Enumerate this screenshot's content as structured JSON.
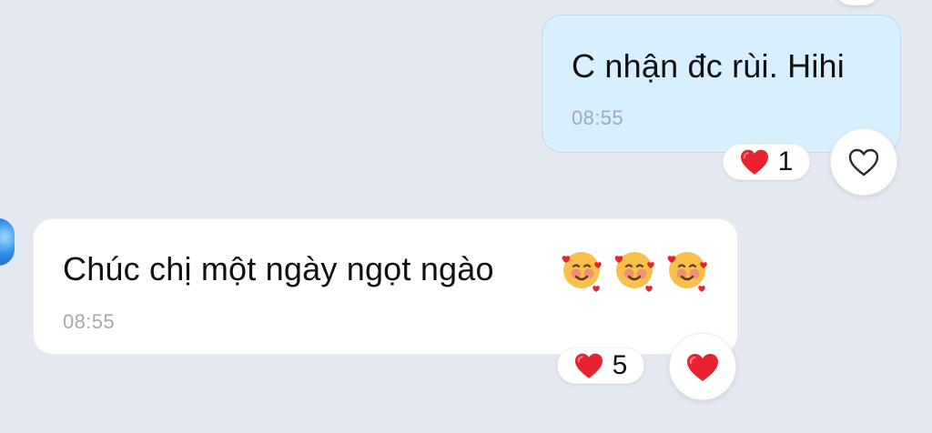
{
  "colors": {
    "background": "#e4e8f1",
    "sent_bubble": "#d7efff",
    "received_bubble": "#ffffff",
    "timestamp": "#a1a9b4",
    "heart_red": "#e8222e"
  },
  "messages": [
    {
      "side": "sent",
      "text": "C nhận đc rùi. Hihi",
      "time": "08:55",
      "reaction": {
        "icon": "red-heart-icon",
        "count": "1"
      },
      "react_button": {
        "icon": "heart-outline-icon",
        "state": "not-reacted"
      }
    },
    {
      "side": "received",
      "text": "Chúc chị một ngày ngọt ngào",
      "emoji": [
        "smiling-face-with-hearts-icon",
        "smiling-face-with-hearts-icon",
        "smiling-face-with-hearts-icon"
      ],
      "time": "08:55",
      "reaction": {
        "icon": "red-heart-icon",
        "count": "5"
      },
      "react_button": {
        "icon": "heart-filled-icon",
        "state": "reacted"
      }
    }
  ]
}
